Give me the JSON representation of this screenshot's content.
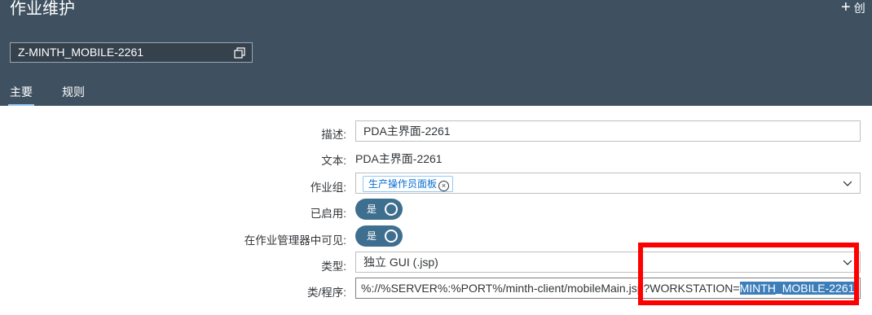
{
  "header": {
    "title": "作业维护",
    "create_label": "创",
    "id_field": "Z-MINTH_MOBILE-2261",
    "tabs": [
      {
        "label": "主要",
        "active": true
      },
      {
        "label": "规则",
        "active": false
      }
    ]
  },
  "form": {
    "description": {
      "label": "描述:",
      "value": "PDA主界面-2261"
    },
    "text": {
      "label": "文本:",
      "value": "PDA主界面-2261"
    },
    "job_group": {
      "label": "作业组:",
      "token": "生产操作员面板"
    },
    "enabled": {
      "label": "已启用:",
      "state": "是"
    },
    "visible": {
      "label": "在作业管理器中可见:",
      "state": "是"
    },
    "type": {
      "label": "类型:",
      "value": "独立 GUI (.jsp)"
    },
    "program": {
      "label": "类/程序:",
      "value_prefix": "%://%SERVER%:%PORT%/minth-client/mobileMain.jsp?WORKSTATION=",
      "value_selected": "MINTH_MOBILE-2261"
    }
  },
  "colors": {
    "header_bg": "#3f5161",
    "tab_underline": "#91c8f6",
    "switch_on": "#3f6f8f",
    "selection": "#3c7eba",
    "annotation": "#ff0000"
  }
}
